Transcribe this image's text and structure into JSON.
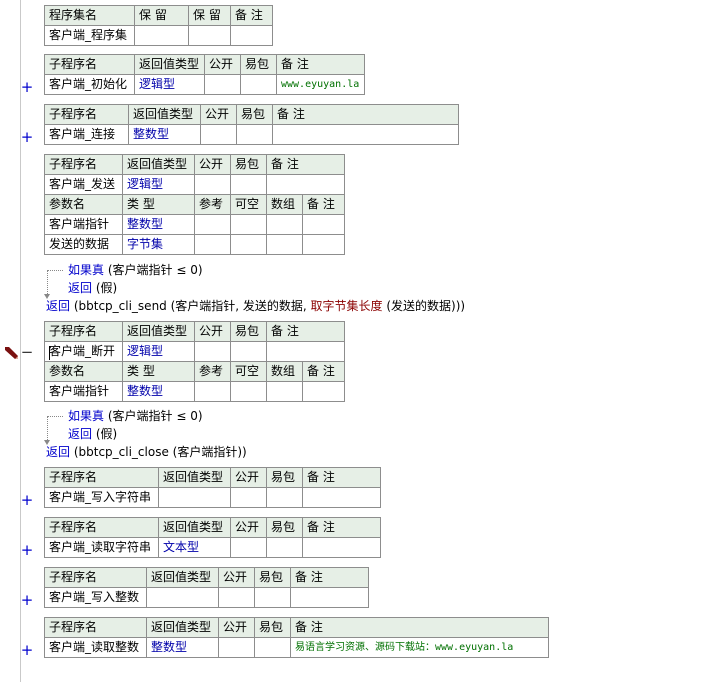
{
  "assembly": {
    "headers": [
      "程序集名",
      "保 留",
      "保 留",
      "备 注"
    ],
    "row": [
      "客户端_程序集",
      "",
      "",
      ""
    ]
  },
  "sub_headers": [
    "子程序名",
    "返回值类型",
    "公开",
    "易包",
    "备 注"
  ],
  "param_headers": [
    "参数名",
    "类 型",
    "参考",
    "可空",
    "数组",
    "备 注"
  ],
  "expand_symbol": "+",
  "collapse_symbol": "−",
  "subs": {
    "init": {
      "name": "客户端_初始化",
      "type": "逻辑型",
      "note": "www.eyuyan.la"
    },
    "conn": {
      "name": "客户端_连接",
      "type": "整数型",
      "note": ""
    },
    "send": {
      "name": "客户端_发送",
      "type": "逻辑型",
      "note": "",
      "params": [
        {
          "name": "客户端指针",
          "type": "整数型"
        },
        {
          "name": "发送的数据",
          "type": "字节集"
        }
      ]
    },
    "close": {
      "name": "客户端_断开",
      "type": "逻辑型",
      "note": "",
      "params": [
        {
          "name": "客户端指针",
          "type": "整数型"
        }
      ]
    },
    "writestr": {
      "name": "客户端_写入字符串",
      "type": "",
      "note": ""
    },
    "readstr": {
      "name": "客户端_读取字符串",
      "type": "文本型",
      "note": ""
    },
    "writeint": {
      "name": "客户端_写入整数",
      "type": "",
      "note": ""
    },
    "readint": {
      "name": "客户端_读取整数",
      "type": "整数型",
      "note": "易语言学习资源、源码下载站：www.eyuyan.la"
    }
  },
  "code": {
    "send_if_kw": "如果真",
    "send_if_cond": " (客户端指针 ≤ 0)",
    "send_ret_kw": "返回",
    "send_ret_val": " (假)",
    "send_final_kw": "返回",
    "send_final_a": " (bbtcp_cli_send (客户端指针, 发送的数据, ",
    "send_final_fn": "取字节集长度",
    "send_final_b": " (发送的数据)))",
    "close_if_kw": "如果真",
    "close_if_cond": " (客户端指针 ≤ 0)",
    "close_ret_kw": "返回",
    "close_ret_val": " (假)",
    "close_final_kw": "返回",
    "close_final_a": " (bbtcp_cli_close (客户端指针))"
  }
}
